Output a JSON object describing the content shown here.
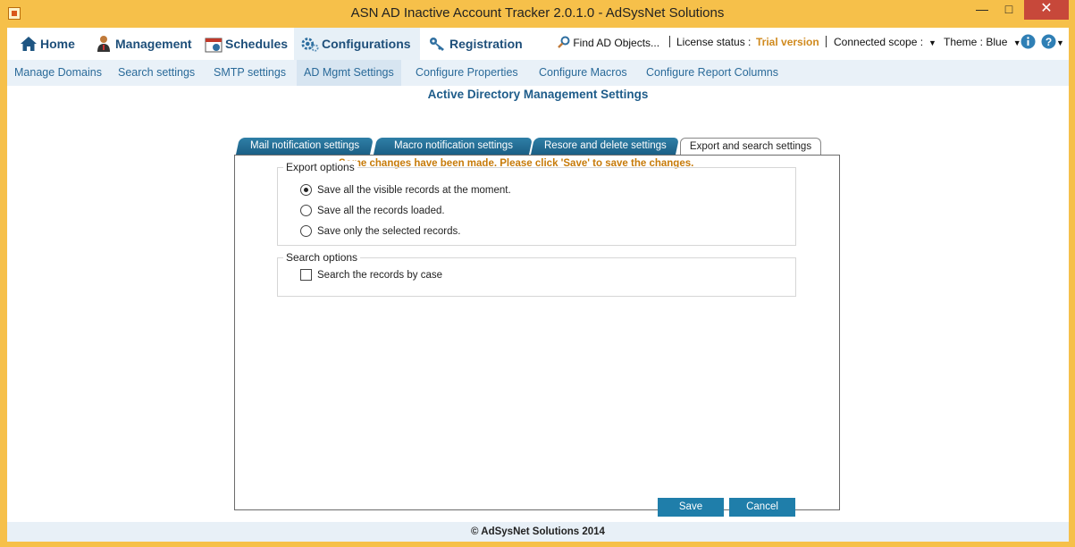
{
  "window": {
    "title": "ASN AD Inactive Account Tracker 2.0.1.0 - AdSysNet Solutions",
    "min_symbol": "—",
    "max_symbol": "□",
    "close_symbol": "✕"
  },
  "main_nav": {
    "items": [
      {
        "label": "Home",
        "icon": "home-icon"
      },
      {
        "label": "Management",
        "icon": "user-manager-icon"
      },
      {
        "label": "Schedules",
        "icon": "calendar-icon"
      },
      {
        "label": "Configurations",
        "icon": "gears-icon"
      },
      {
        "label": "Registration",
        "icon": "key-icon"
      }
    ],
    "active": "Configurations"
  },
  "status_bar": {
    "find_label": "Find AD Objects...",
    "license_label": "License status :",
    "license_value": "Trial version",
    "scope_label": "Connected scope :",
    "theme_label": "Theme : Blue"
  },
  "sub_nav": {
    "items": [
      "Manage Domains",
      "Search settings",
      "SMTP settings",
      "AD Mgmt Settings",
      "Configure Properties",
      "Configure Macros",
      "Configure Report Columns"
    ],
    "active": "AD Mgmt Settings"
  },
  "page": {
    "title": "Active Directory Management Settings",
    "warning": "Some changes have been made. Please click 'Save' to save the changes."
  },
  "tabs": [
    "Mail notification settings",
    "Macro  notification settings",
    "Resore and delete settings",
    "Export and search settings"
  ],
  "export_options": {
    "label": "Export options",
    "options": [
      "Save all the visible records at the moment.",
      "Save all the records loaded.",
      "Save only the selected records."
    ],
    "selected_index": 0
  },
  "search_options": {
    "label": "Search options",
    "case_label": "Search the records by case",
    "case_checked": false
  },
  "buttons": {
    "save": "Save",
    "cancel": "Cancel"
  },
  "footer": {
    "text": "© AdSysNet Solutions 2014"
  },
  "colors": {
    "accent": "#1f7eaa",
    "nav_text": "#1e4f7a",
    "trial": "#d08a1e",
    "warning": "#c77b0a",
    "title_bar": "#f6c04a"
  }
}
